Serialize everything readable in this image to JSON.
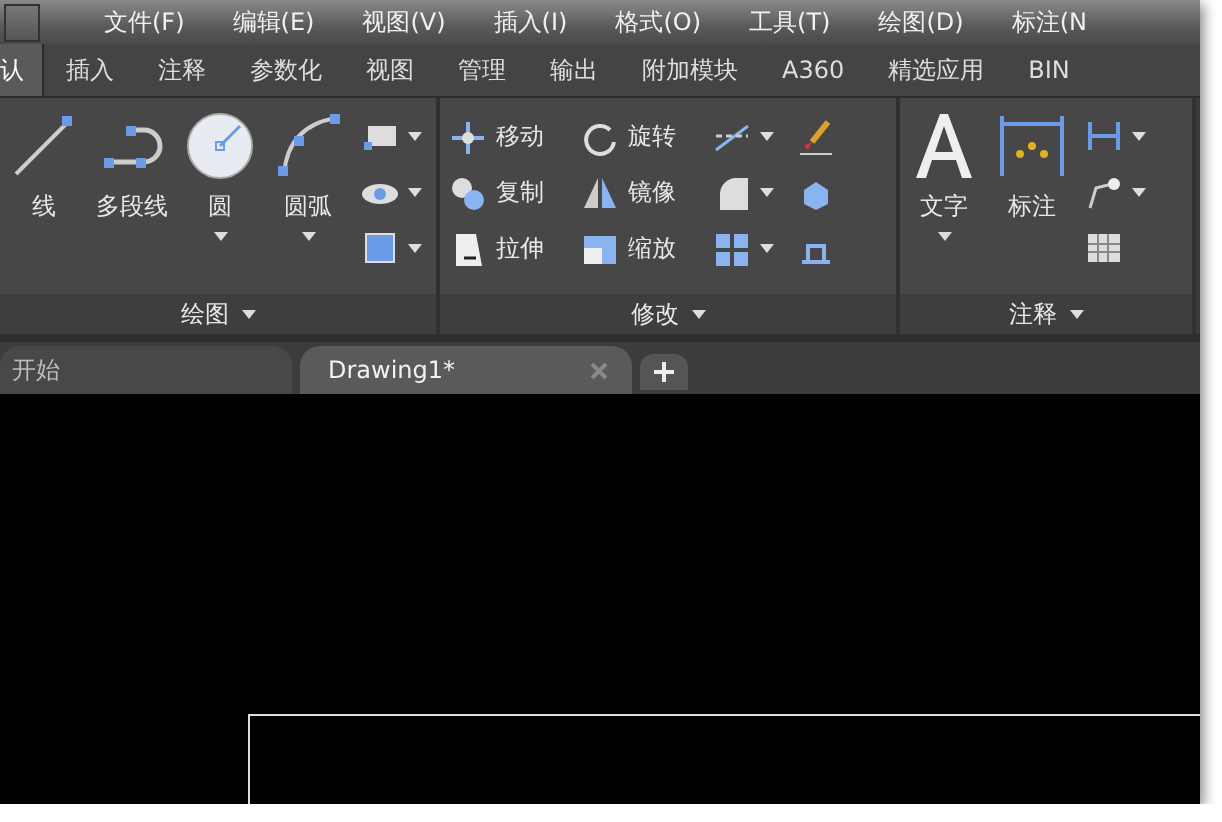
{
  "menu_bar": {
    "items": [
      "文件(F)",
      "编辑(E)",
      "视图(V)",
      "插入(I)",
      "格式(O)",
      "工具(T)",
      "绘图(D)",
      "标注(N"
    ]
  },
  "ribbon_tabs": [
    {
      "label": "认",
      "selected": true
    },
    {
      "label": "插入",
      "selected": false
    },
    {
      "label": "注释",
      "selected": false
    },
    {
      "label": "参数化",
      "selected": false
    },
    {
      "label": "视图",
      "selected": false
    },
    {
      "label": "管理",
      "selected": false
    },
    {
      "label": "输出",
      "selected": false
    },
    {
      "label": "附加模块",
      "selected": false
    },
    {
      "label": "A360",
      "selected": false
    },
    {
      "label": "精选应用",
      "selected": false
    },
    {
      "label": "BIN",
      "selected": false
    }
  ],
  "panels": [
    {
      "kind": "draw",
      "title": "绘图",
      "large_tools": [
        {
          "label": "线",
          "dropdown": false
        },
        {
          "label": "多段线",
          "dropdown": false
        },
        {
          "label": "圆",
          "dropdown": true
        },
        {
          "label": "圆弧",
          "dropdown": true
        }
      ],
      "small_tools": [
        {
          "dropdown": true
        },
        {
          "dropdown": true
        },
        {
          "dropdown": true
        }
      ]
    },
    {
      "kind": "grid",
      "title": "修改",
      "rows": [
        {
          "tools": [
            {
              "kind": "labeled",
              "label": "移动"
            },
            {
              "kind": "labeled",
              "label": "旋转"
            },
            {
              "kind": "icon",
              "dropdown": true
            },
            {
              "kind": "icon",
              "dropdown": false
            }
          ]
        },
        {
          "tools": [
            {
              "kind": "labeled",
              "label": "复制"
            },
            {
              "kind": "labeled",
              "label": "镜像"
            },
            {
              "kind": "icon",
              "dropdown": true
            },
            {
              "kind": "icon",
              "dropdown": false
            }
          ]
        },
        {
          "tools": [
            {
              "kind": "labeled",
              "label": "拉伸"
            },
            {
              "kind": "labeled",
              "label": "缩放"
            },
            {
              "kind": "icon",
              "dropdown": true
            },
            {
              "kind": "icon",
              "dropdown": false
            }
          ]
        }
      ]
    },
    {
      "kind": "draw",
      "title": "注释",
      "large_tools": [
        {
          "label": "文字",
          "dropdown": true
        },
        {
          "label": "标注",
          "dropdown": false
        }
      ],
      "small_tools": [
        {
          "dropdown": true
        },
        {
          "dropdown": true
        },
        {
          "dropdown": false
        }
      ]
    }
  ],
  "file_tabs": [
    {
      "label": "开始",
      "selected": false,
      "closable": false
    },
    {
      "label": "Drawing1*",
      "selected": true,
      "closable": true
    }
  ]
}
